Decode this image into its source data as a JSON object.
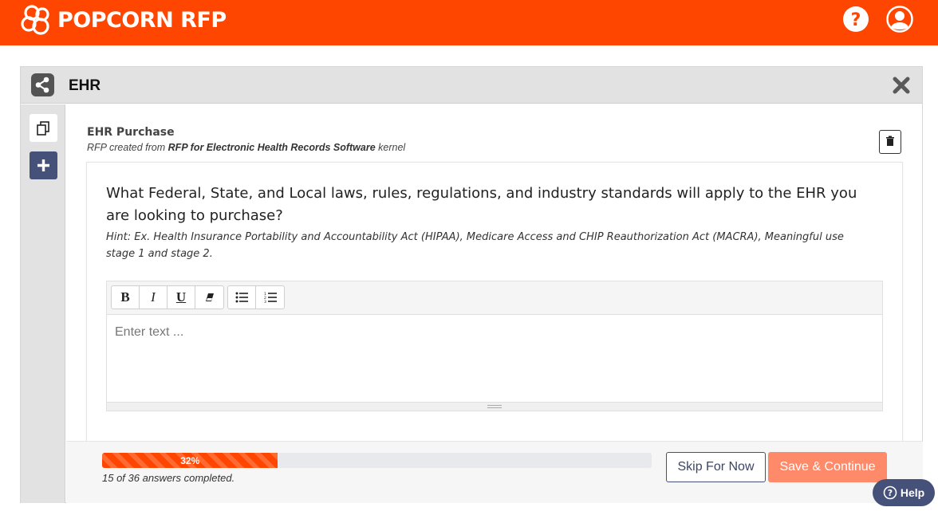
{
  "app": {
    "name": "POPCORN RFP"
  },
  "card": {
    "title": "EHR"
  },
  "rfp": {
    "title": "EHR Purchase",
    "subtitle_prefix": "RFP created from ",
    "subtitle_bold": "RFP for Electronic Health Records Software",
    "subtitle_suffix": " kernel"
  },
  "question": {
    "text": "What Federal, State, and Local laws, rules, regulations, and industry standards will apply to the EHR you are looking to purchase?",
    "hint": "Hint: Ex. Health Insurance Portability and Accountability Act (HIPAA), Medicare Access and CHIP Reauthorization Act (MACRA), Meaningful use stage 1 and stage 2."
  },
  "editor": {
    "placeholder": "Enter text ...",
    "toolbar": {
      "bold": "B",
      "italic": "I",
      "underline": "U"
    }
  },
  "progress": {
    "percent_value": 0.32,
    "percent_label": "32%",
    "status_text": "15 of 36 answers completed."
  },
  "buttons": {
    "skip": "Skip For Now",
    "save": "Save & Continue",
    "help": "Help"
  },
  "colors": {
    "brand": "#ff4600",
    "navy": "#46517a",
    "save_button": "#ff8a6a"
  }
}
